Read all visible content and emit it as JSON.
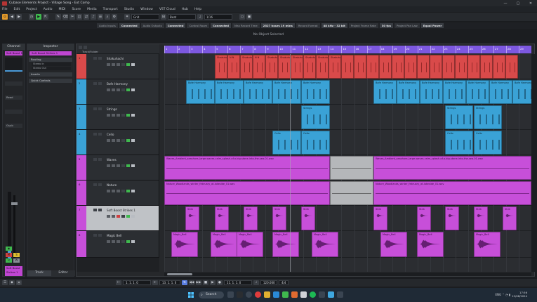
{
  "window": {
    "title": "Cubase Elements Project - Village Song - Ext Comp",
    "minimize": "—",
    "maximize": "▢",
    "close": "✕"
  },
  "menu": [
    "File",
    "Edit",
    "Project",
    "Audio",
    "MIDI",
    "Score",
    "Media",
    "Transport",
    "Studio",
    "Window",
    "VST Cloud",
    "Hub",
    "Help"
  ],
  "toolbar": {
    "grid_type": "Grid",
    "quantize": "Beat",
    "quantize_value": "1/16",
    "buttons": [
      "⊙",
      "◀",
      "▶",
      "✎",
      "⌫",
      "✂",
      "◫",
      "⇄",
      "♪",
      "☰",
      "⌕",
      "⚙"
    ]
  },
  "status_line": [
    {
      "label": "Audio Inputs",
      "value": "Connected"
    },
    {
      "label": "Audio Outputs",
      "value": "Connected"
    },
    {
      "label": "Control Room",
      "value": "Connected"
    },
    {
      "label": "Max Record Time",
      "value": "2527 hours 19 mins"
    },
    {
      "label": "Record Format",
      "value": "48 kHz - 32 bit"
    },
    {
      "label": "Project Frame Rate",
      "value": "30 fps"
    },
    {
      "label": "Project Pan Law",
      "value": "Equal Power"
    }
  ],
  "info_line": "No Object Selected",
  "left_zone": {
    "tab": "Channel",
    "track_label": "Soft Boost Mo...",
    "fields": [
      "",
      "Read",
      "",
      "Gsub"
    ],
    "buttons": {
      "m": "M",
      "s": "S",
      "r": "R",
      "w": "W"
    },
    "bottom_label": "Soft Boost Strikes 1"
  },
  "inspector": {
    "tab": "Inspector",
    "track": "Soft Boost Strikes 1",
    "sections": [
      {
        "title": "Routing",
        "fields": [
          "Stereo In",
          "Stereo Out"
        ]
      },
      {
        "title": "Inserts",
        "fields": []
      },
      {
        "title": "Quick Controls",
        "fields": []
      }
    ],
    "bottom_tabs": [
      "Track",
      "Editor"
    ]
  },
  "project": {
    "tracklist_label": "Track/Folder",
    "tracks": [
      {
        "num": "1",
        "name": "Shakuhachi",
        "color": "#d94a4a"
      },
      {
        "num": "2",
        "name": "Bofe Harmony",
        "color": "#3aa2d6"
      },
      {
        "num": "3",
        "name": "Strings",
        "color": "#3aa2d6"
      },
      {
        "num": "4",
        "name": "Cello",
        "color": "#3aa2d6"
      },
      {
        "num": "5",
        "name": "Waves",
        "color": "#c74fd9"
      },
      {
        "num": "6",
        "name": "Nature",
        "color": "#c74fd9"
      },
      {
        "num": "7",
        "name": "Soft Boost Strikes 1",
        "color": "#c74fd9"
      },
      {
        "num": "8",
        "name": "Magic Bell",
        "color": "#c74fd9"
      }
    ],
    "ruler_labels": [
      "1",
      "2",
      "3",
      "4",
      "5",
      "6",
      "7",
      "8",
      "9",
      "10",
      "11",
      "12",
      "13",
      "14",
      "15",
      "16",
      "17",
      "18",
      "19",
      "20",
      "21",
      "22",
      "23",
      "24",
      "25",
      "26",
      "27",
      "28",
      "29"
    ],
    "events": {
      "shakuhachi": [
        "Shakuhachi",
        "N N",
        "Shakuhachi",
        "N N",
        "Shakuhachi",
        "Shakuhachi",
        "Shakuhachi",
        "Shakuhachi",
        "Shakuhachi",
        "Shakuhachi"
      ],
      "harmony": [
        "Bofe Harmony",
        "Bofe Harmony",
        "Bofe Harmony",
        "Bofe Harmony",
        "Bofe Harmony",
        "Bofe Harmony",
        "Bofe Harmony",
        "Bofe Harmony",
        "Bofe Harmony",
        "Bofe Harmony"
      ],
      "strings": [
        "Strings",
        "Strings",
        "Strings"
      ],
      "cello": [
        "Cello",
        "Cello",
        "Cello",
        "Cello"
      ],
      "waves_long": "Waves_Ambient_seashore_large-waves-calm_splash-of-a-big-stone-into-the-sea-01.wav",
      "waves_short": "Waves_Ambient_seashore_large-waves-calm_splash-of-a-big-stone-into-the-sea-01.wav",
      "nature_long": "Nature_Woodlands_winter_february_at-lakeside_01.wav",
      "nature_short": "Nature_Woodlands_winter_february_at-lakeside_01.wav",
      "strikes": "Strik",
      "bell": "Magic_Bell"
    }
  },
  "transport": {
    "left_locator": "1. 1. 1. 0",
    "right_locator": "13. 1. 1. 0",
    "position": "11. 1. 1. 0",
    "tempo": "120.000",
    "signature": "4/4",
    "buttons": [
      "◀◀",
      "▶▶",
      "■",
      "▶",
      "●",
      "↻"
    ]
  },
  "taskbar": {
    "search": "Search",
    "time": "17:56",
    "date": "15/08/2024",
    "tray": "ENG  ⌃  ◔  ▮"
  },
  "colors": {
    "red_track": "#d94a4a",
    "blue_track": "#3aa2d6",
    "purple_track": "#c74fd9",
    "ruler": "#7d58e0",
    "accent_orange": "#e39a2a",
    "accent_green": "#3fb94e"
  }
}
